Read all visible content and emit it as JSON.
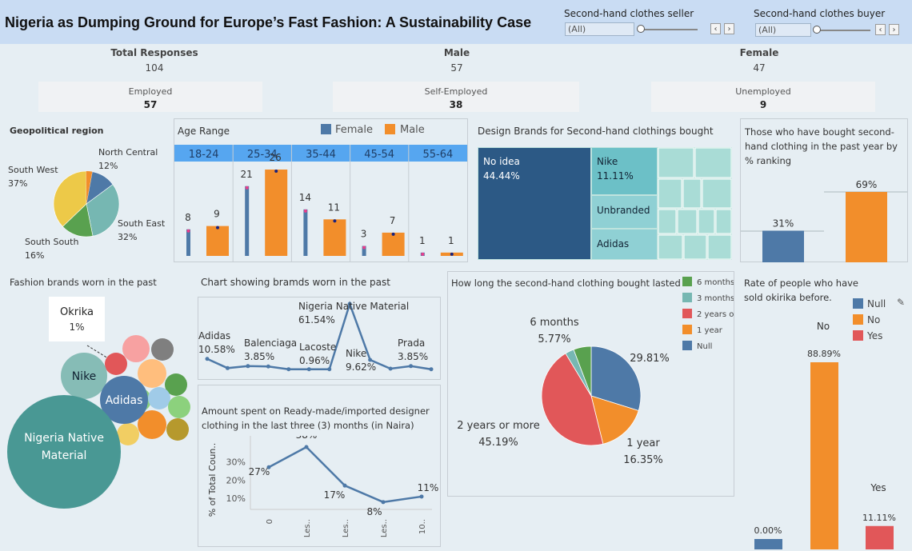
{
  "header": {
    "title": "Nigeria as Dumping Ground for Europe’s Fast Fashion: A Sustainability Case",
    "filter_seller": {
      "label": "Second-hand clothes seller",
      "value": "(All)"
    },
    "filter_buyer": {
      "label": "Second-hand clothes buyer",
      "value": "(All)"
    }
  },
  "kpis": {
    "total": {
      "label": "Total Responses",
      "value": "104"
    },
    "male": {
      "label": "Male",
      "value": "57"
    },
    "female": {
      "label": "Female",
      "value": "47"
    },
    "employed": {
      "label": "Employed",
      "value": "57"
    },
    "self_employed": {
      "label": "Self-Employed",
      "value": "38"
    },
    "unemployed": {
      "label": "Unemployed",
      "value": "9"
    }
  },
  "colors": {
    "blue": "#4e79a7",
    "orange": "#f28e2b",
    "red": "#e15759",
    "green": "#59a14f",
    "teal": "#76b7b2",
    "yellow": "#edc948",
    "navy": "#2c5985"
  },
  "chart_data": [
    {
      "id": "geo",
      "type": "pie",
      "title": "Geopolitical region",
      "slices": [
        {
          "label": "North Central",
          "value": 12,
          "text": "North Central\n12%"
        },
        {
          "label": "South East",
          "value": 32,
          "text": "South East\n32%"
        },
        {
          "label": "South South",
          "value": 16,
          "text": "South South\n16%"
        },
        {
          "label": "South West",
          "value": 37,
          "text": "South West\n37%"
        }
      ]
    },
    {
      "id": "age",
      "type": "bar",
      "title": "Age Range",
      "legend": [
        "Female",
        "Male"
      ],
      "categories": [
        "18-24",
        "25-34",
        "35-44",
        "45-54",
        "55-64"
      ],
      "series": [
        {
          "name": "Female",
          "values": [
            8,
            21,
            14,
            3,
            1
          ]
        },
        {
          "name": "Male",
          "values": [
            9,
            26,
            11,
            7,
            1
          ]
        }
      ]
    },
    {
      "id": "design",
      "type": "heatmap",
      "title": "Design Brands for Second-hand clothings bought",
      "cells": [
        {
          "label": "No idea",
          "value": "44.44%"
        },
        {
          "label": "Nike",
          "value": "11.11%"
        },
        {
          "label": "Unbranded",
          "value": ""
        },
        {
          "label": "Adidas",
          "value": ""
        }
      ]
    },
    {
      "id": "bought",
      "type": "bar",
      "title": "Those who have bought second-hand clothing in the past year by % ranking",
      "categories": [
        "",
        ""
      ],
      "values": [
        31,
        69
      ],
      "labels": [
        "31%",
        "69%"
      ]
    },
    {
      "id": "brands_bubble",
      "type": "scatter",
      "title": "Fashion brands worn in the past",
      "tooltip": {
        "label": "Okrika",
        "value": "1%"
      },
      "bubbles": [
        "Nike",
        "Adidas",
        "Nigeria Native\nMaterial"
      ]
    },
    {
      "id": "brands_line",
      "type": "line",
      "title": "Chart showing bramds worn in the past",
      "values": [
        10.58,
        2,
        3.85,
        3.5,
        0.96,
        0.96,
        0.96,
        61.54,
        9.62,
        1.5,
        3.85,
        0.96
      ],
      "labels": [
        {
          "text": "Adidas\n10.58%"
        },
        {
          "text": "Balenciaga\n3.85%"
        },
        {
          "text": "Lacoste\n0.96%"
        },
        {
          "text": "Nigeria Native Material\n61.54%"
        },
        {
          "text": "Nike\n9.62%"
        },
        {
          "text": "Prada\n3.85%"
        }
      ]
    },
    {
      "id": "amount",
      "type": "line",
      "title": "Amount spent on Ready-made/imported designer clothing in the last three (3) months (in Naira)",
      "ylabel": "% of Total Coun..",
      "x": [
        "0",
        "Les..",
        "Les..",
        "Les..",
        "10.."
      ],
      "values": [
        27,
        38,
        17,
        8,
        11
      ],
      "labels": [
        "27%",
        "38%",
        "17%",
        "8%",
        "11%"
      ],
      "yticks": [
        "10%",
        "20%",
        "30%"
      ]
    },
    {
      "id": "lasted",
      "type": "pie",
      "title": "How long the second-hand clothing bought lasted",
      "legend": [
        "6 months",
        "3 months",
        "2 years or m...",
        "1 year",
        "Null"
      ],
      "slices": [
        {
          "label": "Null",
          "value": 29.81,
          "text": "29.81%"
        },
        {
          "label": "1 year",
          "value": 16.35,
          "text": "1 year\n16.35%"
        },
        {
          "label": "2 years or more",
          "value": 45.19,
          "text": "2 years or more\n45.19%"
        },
        {
          "label": "3 months",
          "value": 2.88,
          "text": ""
        },
        {
          "label": "6 months",
          "value": 5.77,
          "text": "6 months\n5.77%"
        }
      ]
    },
    {
      "id": "sold",
      "type": "bar",
      "title": "Rate of people who have sold okirika before.",
      "legend": [
        "Null",
        "No",
        "Yes"
      ],
      "categories": [
        "Null",
        "No",
        "Yes"
      ],
      "values": [
        0,
        88.89,
        11.11
      ],
      "labels": [
        "0.00%",
        "88.89%",
        "11.11%"
      ],
      "headers": [
        "No",
        "Yes"
      ]
    }
  ]
}
